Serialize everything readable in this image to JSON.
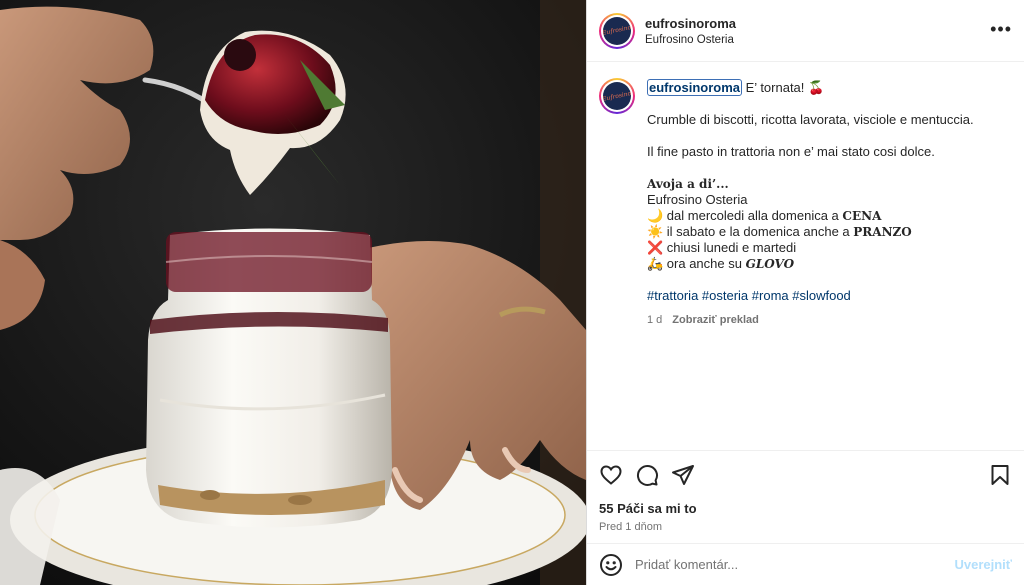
{
  "photo": {
    "alt": "Crumble dessert in jar with cherries"
  },
  "header": {
    "username": "eufrosinoroma",
    "location": "Eufrosino Osteria",
    "avatar_text": "Eufrosino",
    "more_icon": "more-horizontal-icon"
  },
  "caption": {
    "username": "eufrosinoroma",
    "intro": " E’ tornata! 🍒",
    "line1": "Crumble di biscotti, ricotta lavorata, visciole e mentuccia.",
    "line2": "Il fine pasto in trattoria non e’ mai stato cosi dolce.",
    "l3": "Avoja a di’...",
    "l4": "Eufrosino Osteria",
    "l5a": "🌙 dal mercoledi alla domenica a ",
    "l5b": "CENA",
    "l6a": "☀️ il sabato e la domenica anche a ",
    "l6b": "PRANZO",
    "l7": "❌ chiusi lunedi e martedi",
    "l8a": "🛵 ora anche su ",
    "l8b": "GLOVO",
    "hashtags": "#trattoria #osteria #roma #slowfood",
    "age": "1 d",
    "translate": "Zobraziť preklad"
  },
  "actions": {
    "like_icon": "heart-icon",
    "comment_icon": "comment-icon",
    "share_icon": "share-icon",
    "save_icon": "bookmark-icon",
    "likes": "55 Páči sa mi to",
    "time": "Pred 1 dňom"
  },
  "comment": {
    "placeholder": "Pridať komentár...",
    "post_label": "Uverejniť",
    "emoji_icon": "smiley-icon"
  },
  "colors": {
    "link": "#00376b",
    "muted": "#737373",
    "post_disabled": "#b2dffc",
    "avatar_bg": "#1a2a50"
  }
}
